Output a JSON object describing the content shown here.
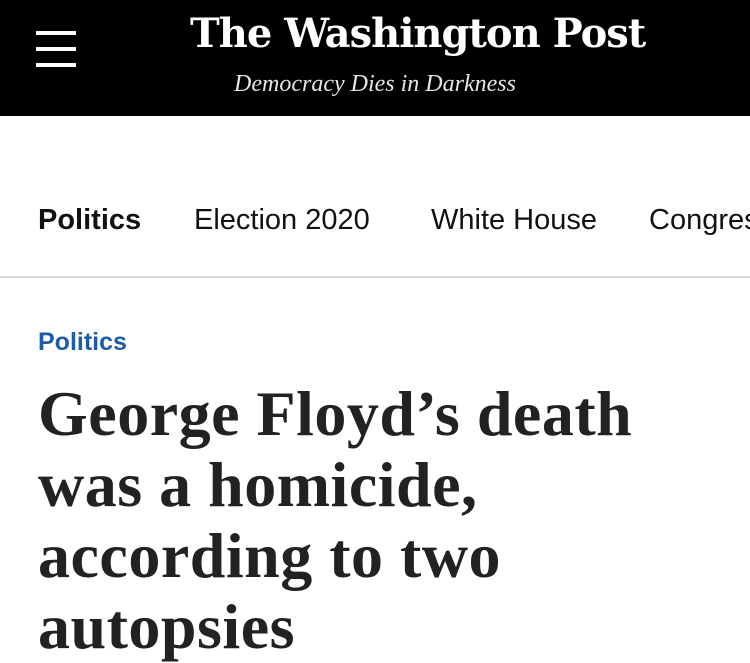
{
  "header": {
    "brand": "The Washington Post",
    "tagline": "Democracy Dies in Darkness",
    "background_color": "#000000",
    "menu_icon": "hamburger-menu-icon"
  },
  "subnav": {
    "items": [
      {
        "label": "Politics",
        "active": true
      },
      {
        "label": "Election 2020",
        "active": false
      },
      {
        "label": "White House",
        "active": false
      },
      {
        "label": "Congress",
        "active": false
      }
    ]
  },
  "article": {
    "section": "Politics",
    "section_color": "#1f5ca8",
    "headline": "George Floyd’s death was a homicide, according to two autopsies"
  }
}
